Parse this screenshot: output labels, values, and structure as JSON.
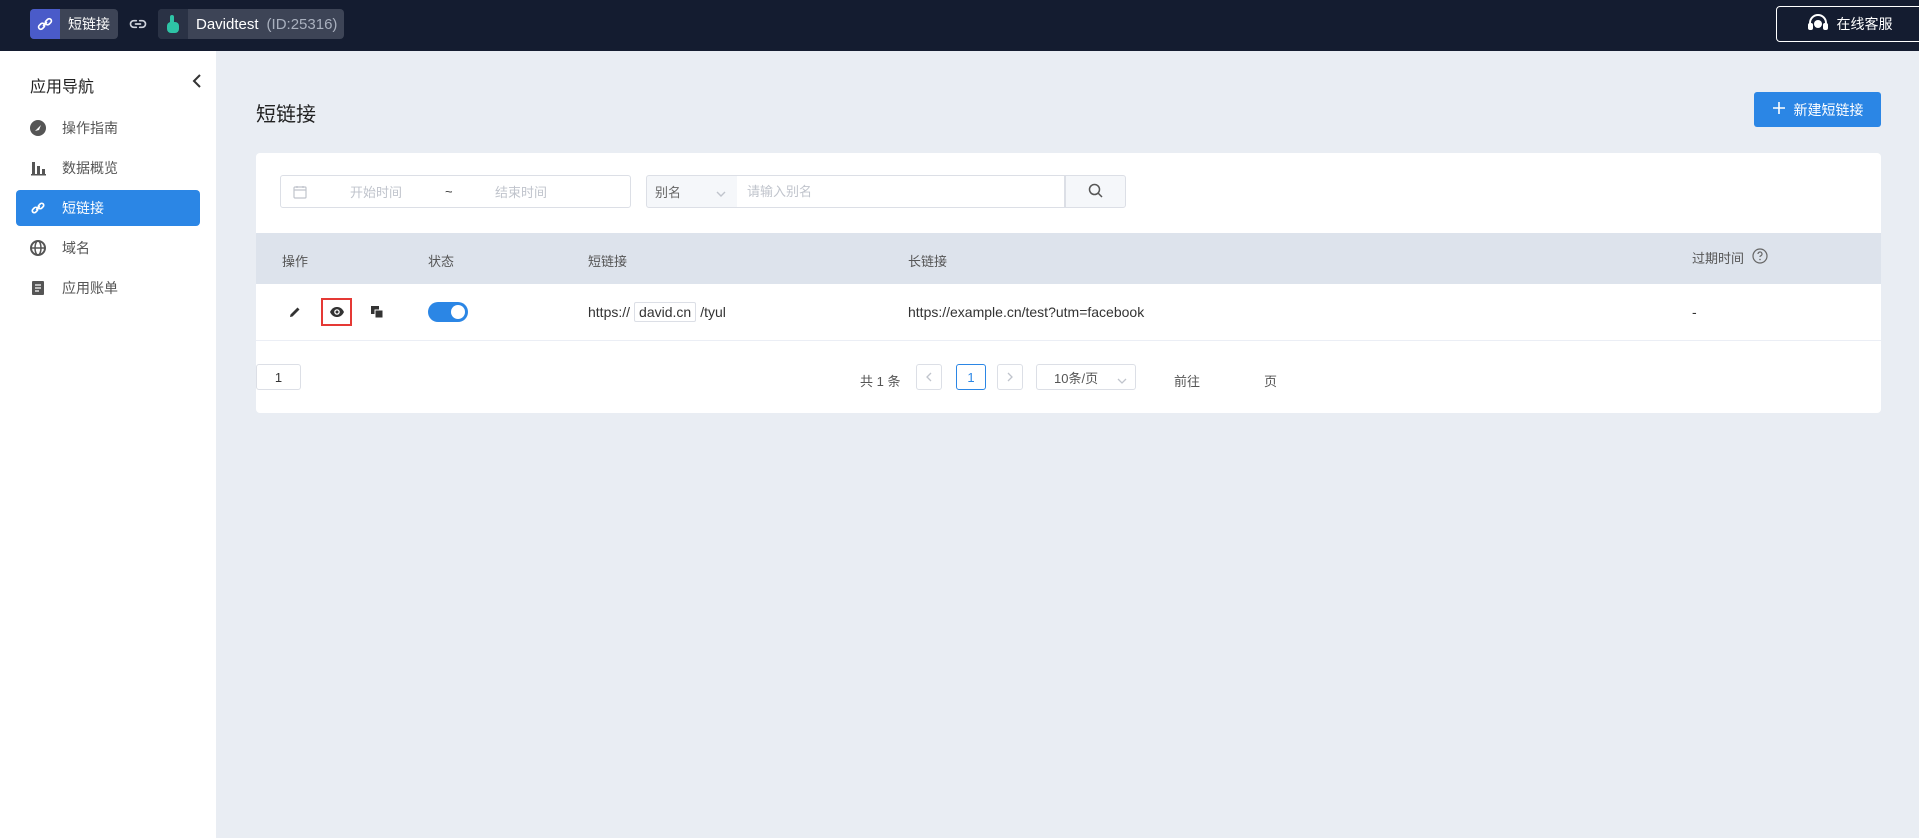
{
  "topbar": {
    "app_name": "短链接",
    "account_name": "Davidtest",
    "account_id": "(ID:25316)",
    "service_label": "在线客服"
  },
  "sidebar": {
    "title": "应用导航",
    "items": [
      {
        "label": "操作指南",
        "icon": "navigation-icon"
      },
      {
        "label": "数据概览",
        "icon": "bar-chart-icon"
      },
      {
        "label": "短链接",
        "icon": "link-icon",
        "active": true
      },
      {
        "label": "域名",
        "icon": "globe-icon"
      },
      {
        "label": "应用账单",
        "icon": "document-icon"
      }
    ]
  },
  "main": {
    "title": "短链接",
    "new_button": "新建短链接"
  },
  "filters": {
    "start_placeholder": "开始时间",
    "separator": "~",
    "end_placeholder": "结束时间",
    "alias_select": "别名",
    "alias_placeholder": "请输入别名"
  },
  "table": {
    "columns": {
      "actions": "操作",
      "status": "状态",
      "short_link": "短链接",
      "long_link": "长链接",
      "expire": "过期时间"
    },
    "rows": [
      {
        "status_enabled": true,
        "short_prefix": "https://",
        "short_domain": "david.cn",
        "short_path": "/tyul",
        "long_link": "https://example.cn/test?utm=facebook",
        "expire": "-"
      }
    ]
  },
  "pagination": {
    "total": "共 1 条",
    "current_page": "1",
    "page_size": "10条/页",
    "goto_label": "前往",
    "goto_value": "1",
    "page_suffix": "页"
  },
  "colors": {
    "topbar": "#141c30",
    "accent": "#2b86e5",
    "highlight": "#e53935"
  }
}
